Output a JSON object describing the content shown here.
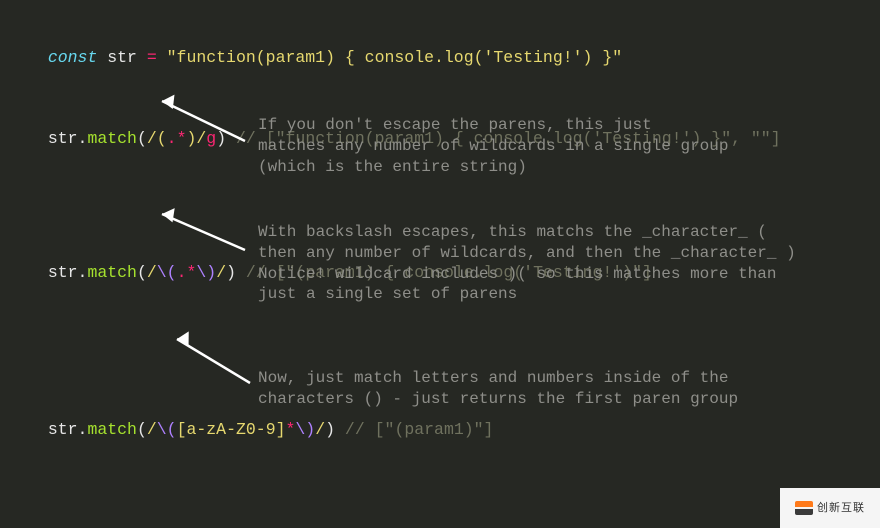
{
  "line1": {
    "const": "const",
    "varname": " str ",
    "eq": "=",
    "string": " \"function(param1) { console.log('Testing!') }\""
  },
  "ex1": {
    "pre": "str",
    "dot": ".",
    "method": "match",
    "open": "(",
    "rd1": "/",
    "rp1": "(",
    "dot_": ".",
    "star": "*",
    "rp2": ")",
    "rd2": "/",
    "flag": "g",
    "close": ")",
    "comment": " // [\"function(param1) { console.log('Testing!') }\", \"\"]"
  },
  "ann1": "If you don't escape the parens, this just\nmatches any number of wildcards in a single group\n(which is the entire string)",
  "ex2": {
    "pre": "str",
    "dot": ".",
    "method": "match",
    "open": "(",
    "rd1": "/",
    "esc1": "\\(",
    "dot_": ".",
    "star": "*",
    "esc2": "\\)",
    "rd2": "/",
    "close": ")",
    "comment": " // [\"(param1) { console.log('Testing!')\"]"
  },
  "ann2": "With backslash escapes, this matchs the _character_ (\nthen any number of wildcards, and then the _character_ )\nNotice! wildcard includes )( so this matches more than\njust a single set of parens",
  "ex3": {
    "pre": "str",
    "dot": ".",
    "method": "match",
    "open": "(",
    "rd1": "/",
    "esc1": "\\(",
    "cls": "[a-zA-Z0-9]",
    "star": "*",
    "esc2": "\\)",
    "rd2": "/",
    "close": ")",
    "comment": " // [\"(param1)\"]"
  },
  "ann3": "Now, just match letters and numbers inside of the\ncharacters () - just returns the first paren group",
  "watermark_text": "创新互联"
}
